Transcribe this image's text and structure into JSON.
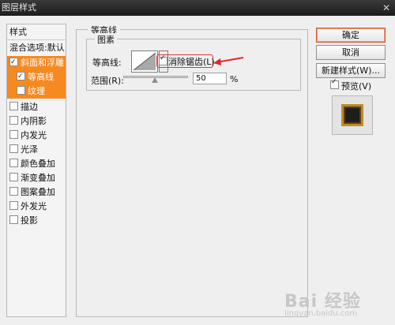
{
  "window": {
    "title": "图层样式",
    "close_glyph": "✕"
  },
  "sidebar": {
    "header": "样式",
    "blend_options": "混合选项:默认",
    "items": [
      {
        "label": "斜面和浮雕",
        "checked": true,
        "highlight": true
      },
      {
        "label": "等高线",
        "checked": true,
        "highlight": true,
        "indent": true
      },
      {
        "label": "纹理",
        "checked": false,
        "indent": true
      },
      {
        "label": "描边",
        "checked": false
      },
      {
        "label": "内阴影",
        "checked": false
      },
      {
        "label": "内发光",
        "checked": false
      },
      {
        "label": "光泽",
        "checked": false
      },
      {
        "label": "颜色叠加",
        "checked": false
      },
      {
        "label": "渐变叠加",
        "checked": false
      },
      {
        "label": "图案叠加",
        "checked": false
      },
      {
        "label": "外发光",
        "checked": false
      },
      {
        "label": "投影",
        "checked": false
      }
    ]
  },
  "panel": {
    "title": "等高线",
    "group_title": "图素",
    "contour_label": "等高线:",
    "antialias_label": "消除锯齿(L)",
    "antialias_checked": true,
    "range_label": "范围(R):",
    "range_value": "50",
    "range_unit": "%",
    "range_fraction": 0.5
  },
  "buttons": {
    "ok": "确定",
    "cancel": "取消",
    "new_style": "新建样式(W)...",
    "preview_label": "预览(V)",
    "preview_checked": true
  },
  "watermark": {
    "text": "Bai 经验",
    "sub": "jingyan.baidu.com"
  },
  "colors": {
    "highlight": "#f6891f",
    "arrow": "#e02a2a",
    "title_bar": "#2a2a2a"
  }
}
